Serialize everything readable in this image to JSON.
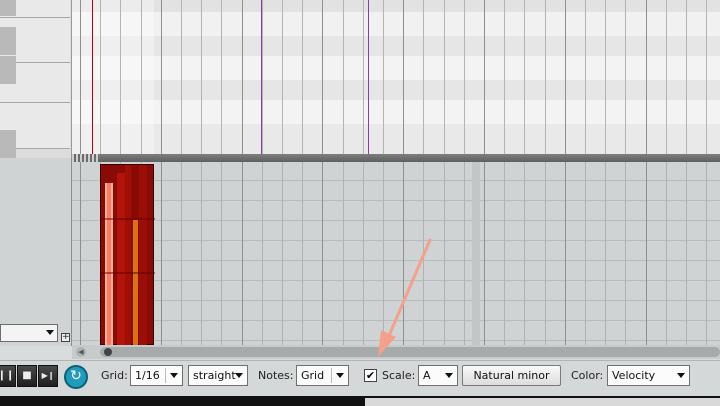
{
  "toolbar": {
    "grid_label": "Grid:",
    "grid_value": "1/16",
    "grid_type_value": "straight",
    "notes_label": "Notes:",
    "notes_value": "Grid",
    "scale_checked": "✔",
    "scale_label": "Scale:",
    "scale_root_value": "A",
    "scale_type_label": "Natural minor",
    "color_label": "Color:",
    "color_value": "Velocity"
  },
  "transport": {
    "pause_icon": "❙❙",
    "stop_icon": "■",
    "next_icon": "▶❙",
    "loop_icon": "↻"
  },
  "left_panel": {
    "dropdown_value": "",
    "expand_icon": "+"
  },
  "colors": {
    "midi_item": "#8a0b05",
    "note_fill": "#ff7a5e",
    "annotation_arrow": "#f4a08c",
    "loop_button": "#1f9bbd",
    "marker_purple": "#8a3aa0",
    "edit_cursor": "#c00000"
  }
}
